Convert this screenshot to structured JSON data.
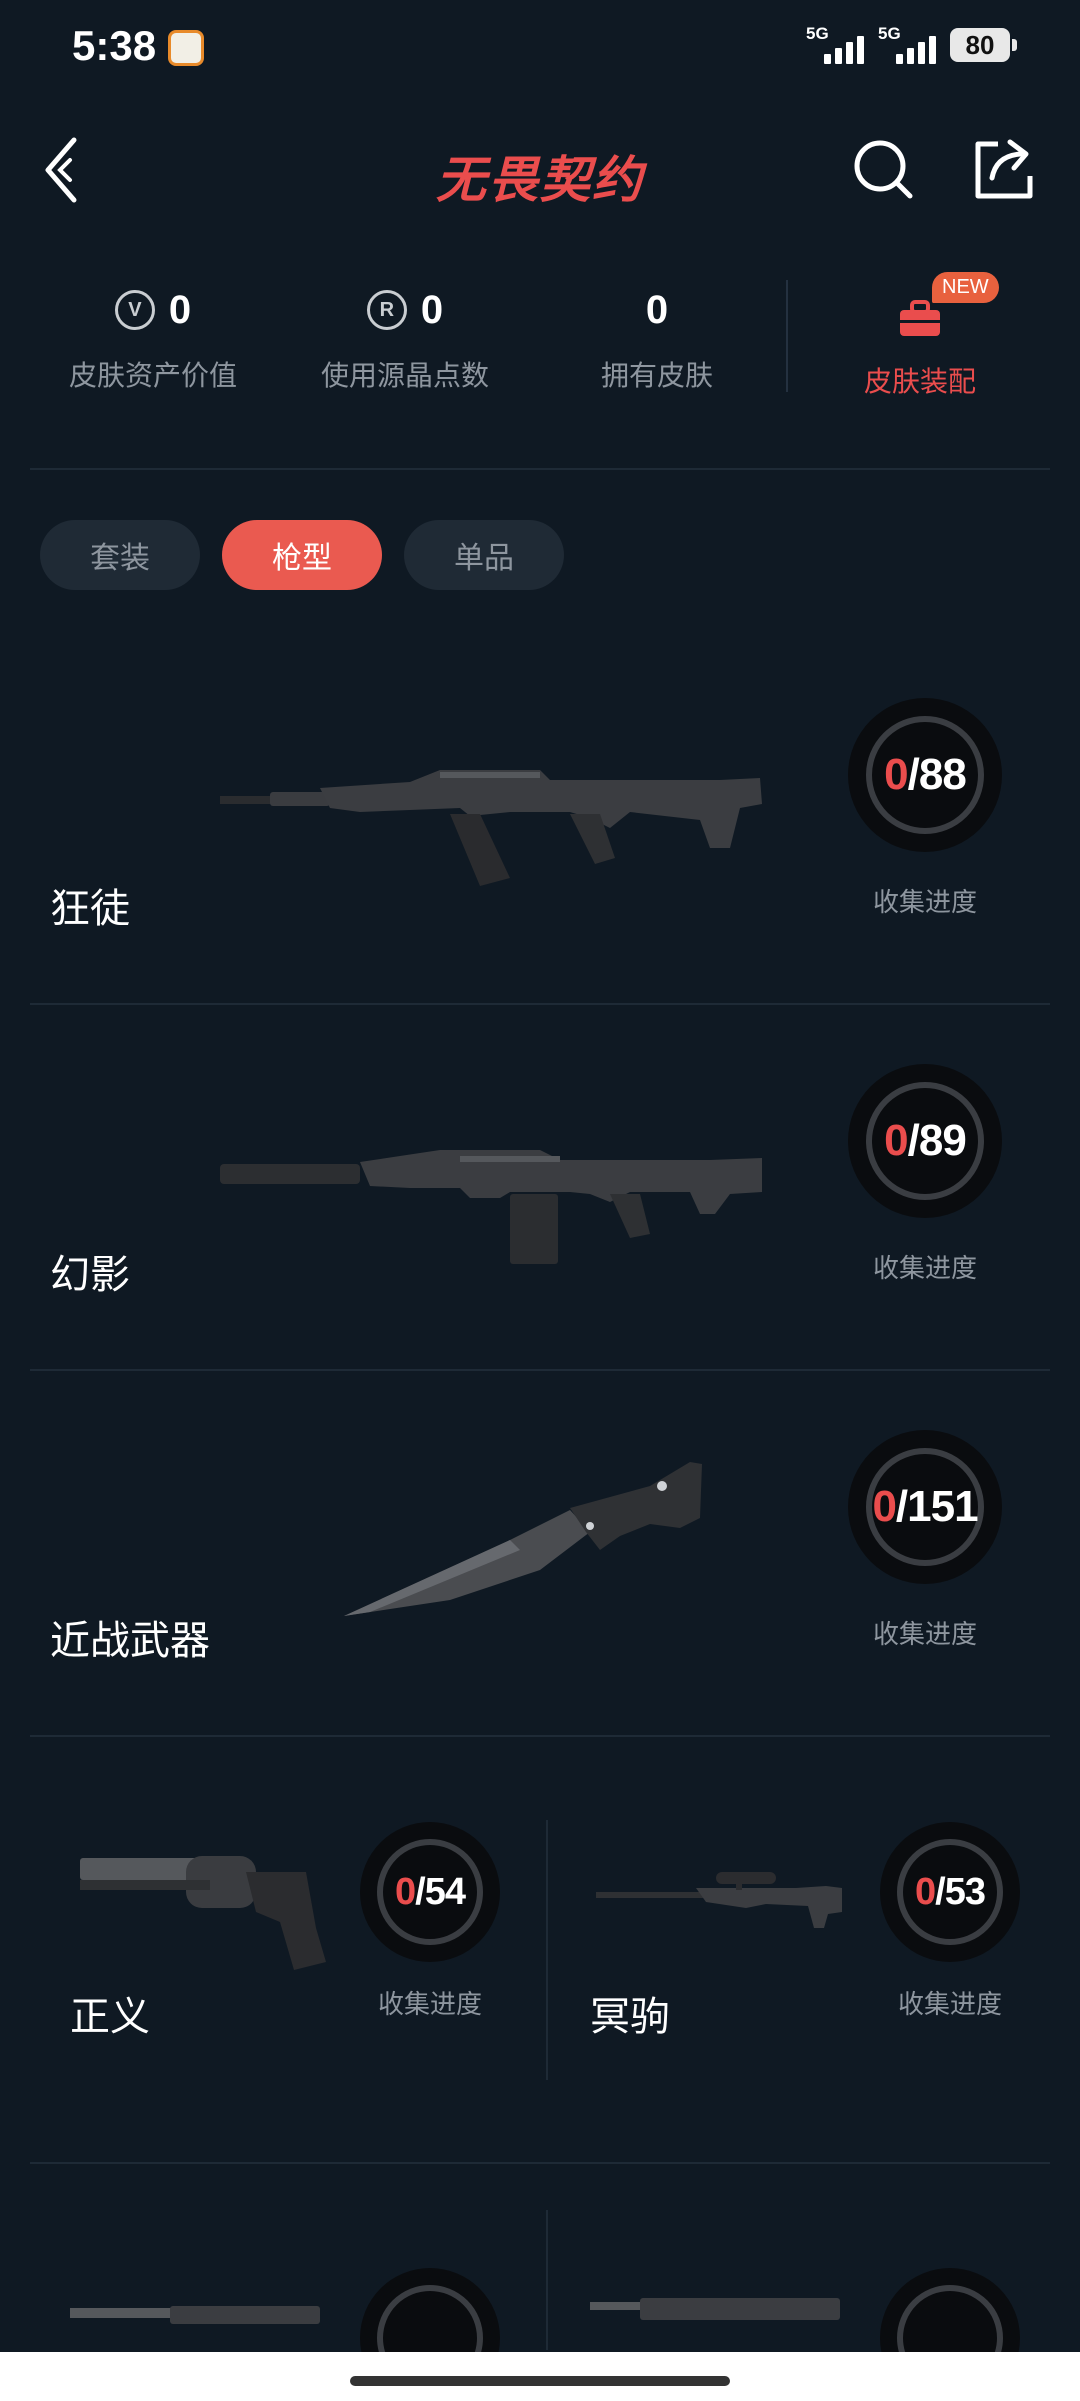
{
  "status_bar": {
    "time": "5:38",
    "signal1_label": "5G",
    "signal2_label": "5G",
    "battery": "80"
  },
  "header": {
    "title": "无畏契约",
    "back_icon": "chevron-left-icon",
    "search_icon": "search-icon",
    "share_icon": "share-icon"
  },
  "stats": [
    {
      "value": "0",
      "label": "皮肤资产价值",
      "icon": "valorant-points-icon"
    },
    {
      "value": "0",
      "label": "使用源晶点数",
      "icon": "radianite-icon"
    },
    {
      "value": "0",
      "label": "拥有皮肤"
    }
  ],
  "equip": {
    "label": "皮肤装配",
    "badge": "NEW"
  },
  "tabs": [
    {
      "label": "套装",
      "active": false
    },
    {
      "label": "枪型",
      "active": true
    },
    {
      "label": "单品",
      "active": false
    }
  ],
  "accent_color": "#ea4d4d",
  "progress_label": "收集进度",
  "weapons": [
    {
      "name": "狂徒",
      "owned": "0",
      "total": "/88",
      "progress": 0
    },
    {
      "name": "幻影",
      "owned": "0",
      "total": "/89",
      "progress": 0
    },
    {
      "name": "近战武器",
      "owned": "0",
      "total": "/151",
      "progress": 0
    }
  ],
  "weapons_half": [
    {
      "name": "正义",
      "owned": "0",
      "total": "/54",
      "progress": 0
    },
    {
      "name": "冥驹",
      "owned": "0",
      "total": "/53",
      "progress": 0
    }
  ]
}
